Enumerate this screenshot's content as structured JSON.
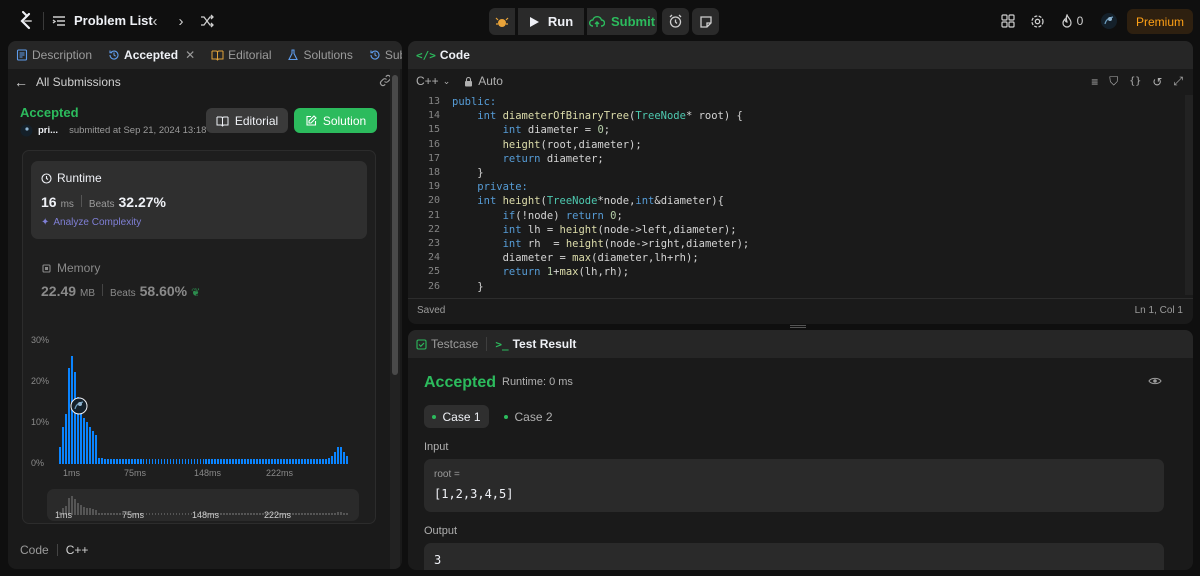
{
  "topbar": {
    "problem_list": "Problem List",
    "run": "Run",
    "submit": "Submit",
    "streak": "0",
    "premium": "Premium"
  },
  "left": {
    "tabs": [
      "Description",
      "Accepted",
      "Editorial",
      "Solutions",
      "Submiss"
    ],
    "back_label": "All Submissions",
    "status": "Accepted",
    "user": "pri...",
    "submitted": "submitted at Sep 21, 2024 13:18",
    "editorial_btn": "Editorial",
    "solution_btn": "Solution",
    "runtime": {
      "title": "Runtime",
      "value": "16",
      "unit": "ms",
      "beats_label": "Beats",
      "beats": "32.27%",
      "analyze": "Analyze Complexity"
    },
    "memory": {
      "title": "Memory",
      "value": "22.49",
      "unit": "MB",
      "beats_label": "Beats",
      "beats": "58.60%"
    },
    "chart_data": {
      "type": "bar",
      "y_ticks": [
        "30%",
        "20%",
        "10%",
        "0%"
      ],
      "x_ticks": [
        "1ms",
        "75ms",
        "148ms",
        "222ms"
      ],
      "ylim": [
        0,
        30
      ],
      "values": [
        4,
        9,
        12,
        23,
        26,
        22,
        16,
        13,
        11,
        10,
        9,
        8,
        7,
        1.5,
        1.4,
        1.3,
        1.3,
        1.2,
        1.2,
        1.2,
        1.2,
        1.1,
        1.1,
        1.1,
        1.1,
        1.1,
        1.1,
        1.1,
        1.1,
        1.1,
        1.1,
        1.1,
        1.1,
        1.1,
        1.1,
        1.1,
        1.1,
        1.1,
        1.1,
        1.1,
        1.1,
        1.1,
        1.1,
        1.1,
        1.1,
        1.1,
        1.1,
        1.1,
        1.1,
        1.1,
        1.1,
        1.1,
        1.1,
        1.1,
        1.1,
        1.1,
        1.1,
        1.1,
        1.1,
        1.1,
        1.1,
        1.1,
        1.1,
        1.1,
        1.1,
        1.1,
        1.1,
        1.1,
        1.1,
        1.1,
        1.1,
        1.1,
        1.1,
        1.1,
        1.1,
        1.1,
        1.1,
        1.1,
        1.1,
        1.1,
        1.1,
        1.1,
        1.1,
        1.1,
        1.1,
        1.1,
        1.1,
        1.1,
        1.2,
        1.2,
        1.4,
        2,
        3,
        4,
        4,
        3,
        2
      ]
    },
    "code_tab": "Code",
    "code_lang": "C++"
  },
  "editor": {
    "title": "Code",
    "lang": "C++",
    "mode": "Auto",
    "lines": [
      {
        "n": "13",
        "code": "public:"
      },
      {
        "n": "14",
        "code": "    int diameterOfBinaryTree(TreeNode* root) {"
      },
      {
        "n": "15",
        "code": "        int diameter = 0;"
      },
      {
        "n": "16",
        "code": "        height(root,diameter);"
      },
      {
        "n": "17",
        "code": "        return diameter;"
      },
      {
        "n": "18",
        "code": "    }"
      },
      {
        "n": "19",
        "code": "    private:"
      },
      {
        "n": "20",
        "code": "    int height(TreeNode*node,int&diameter){"
      },
      {
        "n": "21",
        "code": "        if(!node) return 0;"
      },
      {
        "n": "22",
        "code": "        int lh = height(node->left,diameter);"
      },
      {
        "n": "23",
        "code": "        int rh  = height(node->right,diameter);"
      },
      {
        "n": "24",
        "code": "        diameter = max(diameter,lh+rh);"
      },
      {
        "n": "25",
        "code": "        return 1+max(lh,rh);"
      },
      {
        "n": "26",
        "code": "    }"
      }
    ],
    "saved": "Saved",
    "cursor": "Ln 1, Col 1"
  },
  "result": {
    "tab_testcase": "Testcase",
    "tab_result": "Test Result",
    "status": "Accepted",
    "runtime": "Runtime: 0 ms",
    "case1": "Case 1",
    "case2": "Case 2",
    "input_label": "Input",
    "input_name": "root =",
    "input_value": "[1,2,3,4,5]",
    "output_label": "Output",
    "output_value": "3"
  },
  "colors": {
    "accepted": "#2cbb5d",
    "bar": "#0a84ff",
    "premium": "#ffa116"
  }
}
